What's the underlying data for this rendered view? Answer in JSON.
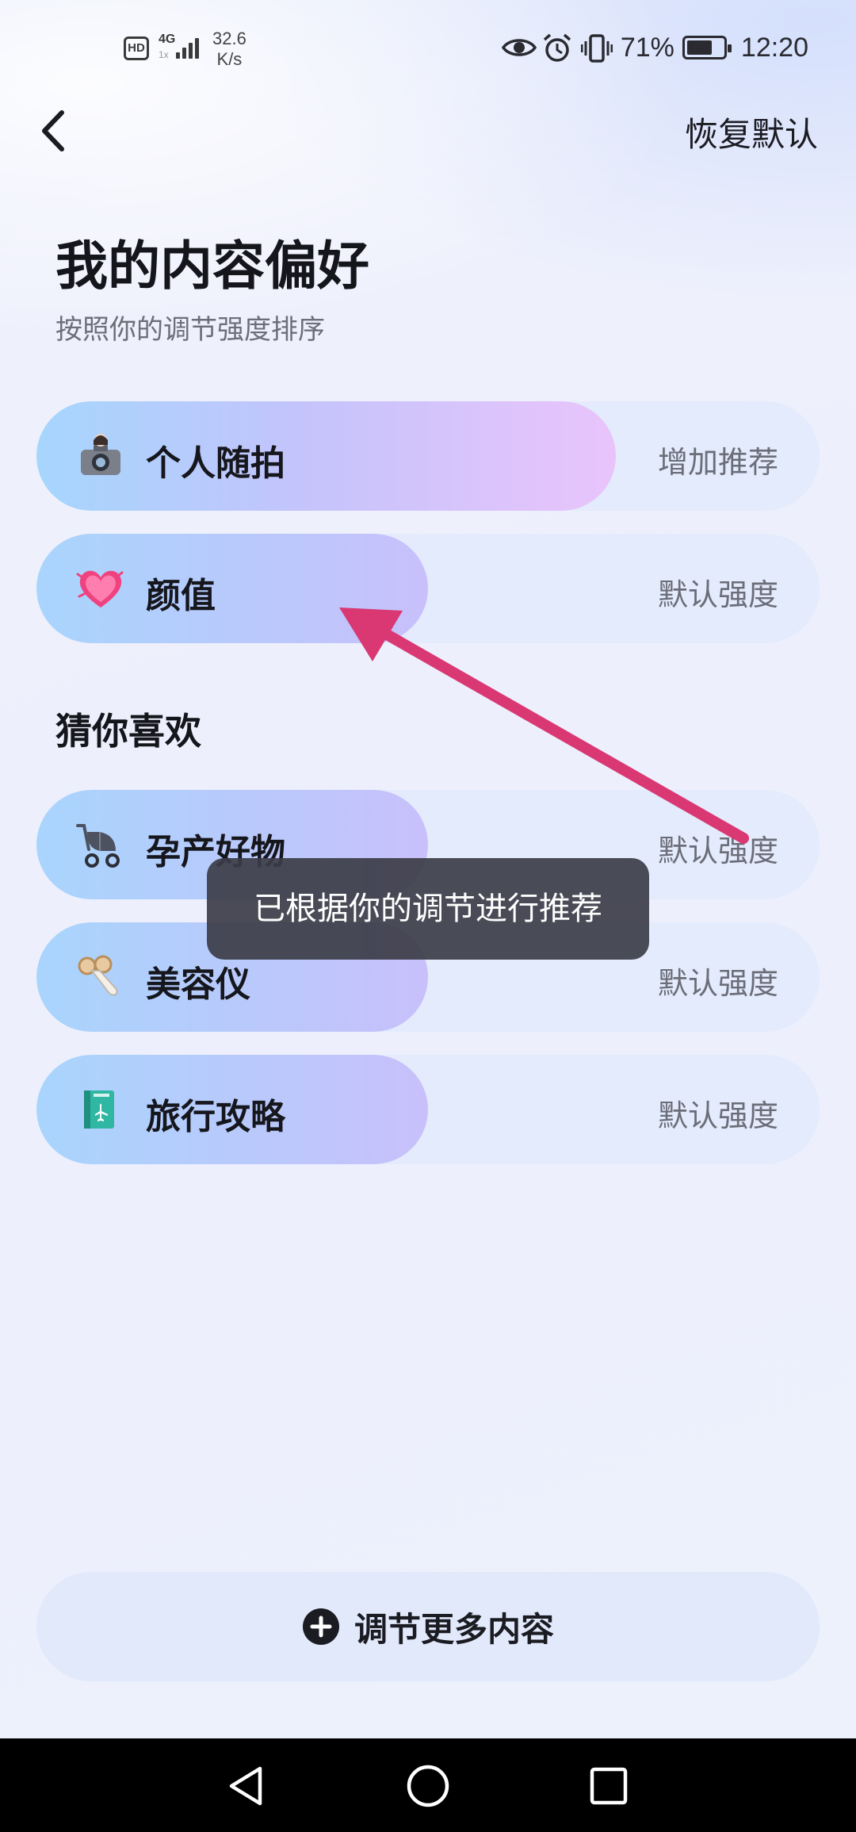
{
  "status_bar": {
    "hd": "HD",
    "network": "4G",
    "network_sub": "1x",
    "speed_value": "32.6",
    "speed_unit": "K/s",
    "battery": "71%",
    "battery_level": 0.71,
    "time": "12:20",
    "icons": [
      "eye-icon",
      "alarm-icon",
      "vibrate-icon",
      "battery-icon"
    ]
  },
  "header": {
    "back_icon": "chevron-left-icon",
    "reset_label": "恢复默认"
  },
  "title": "我的内容偏好",
  "subtitle": "按照你的调节强度排序",
  "preferences": [
    {
      "label": "个人随拍",
      "level": "增加推荐",
      "icon": "camera-girl-icon",
      "fill": 0.74
    },
    {
      "label": "颜值",
      "level": "默认强度",
      "icon": "heart-icon",
      "fill": 0.5
    }
  ],
  "guess_section": {
    "title": "猜你喜欢",
    "items": [
      {
        "label": "孕产好物",
        "level": "默认强度",
        "icon": "stroller-icon",
        "fill": 0.5
      },
      {
        "label": "美容仪",
        "level": "默认强度",
        "icon": "beauty-device-icon",
        "fill": 0.5
      },
      {
        "label": "旅行攻略",
        "level": "默认强度",
        "icon": "travel-guide-icon",
        "fill": 0.5
      }
    ]
  },
  "toast": "已根据你的调节进行推荐",
  "more_button": {
    "label": "调节更多内容",
    "icon": "plus-circle-icon"
  },
  "nav": {
    "icons": [
      "back-triangle-icon",
      "home-circle-icon",
      "recents-square-icon"
    ]
  },
  "colors": {
    "annotation_arrow": "#d93873",
    "toast_bg": "#3c3d48",
    "row_bg": "#e3ebfc"
  }
}
